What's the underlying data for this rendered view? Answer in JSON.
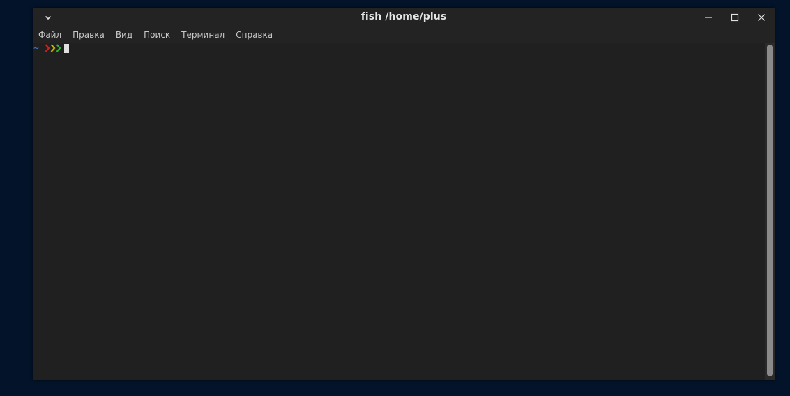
{
  "window": {
    "title": "fish /home/plus"
  },
  "menubar": {
    "items": [
      {
        "label": "Файл"
      },
      {
        "label": "Правка"
      },
      {
        "label": "Вид"
      },
      {
        "label": "Поиск"
      },
      {
        "label": "Терминал"
      },
      {
        "label": "Справка"
      }
    ]
  },
  "terminal": {
    "cwd": "~",
    "prompt_chevrons": [
      "❯",
      "❯",
      "❯"
    ],
    "chevron_colors": [
      "#d02020",
      "#c8b400",
      "#2eb82e"
    ]
  },
  "colors": {
    "desktop_bg": "#03142a",
    "terminal_bg": "#202020",
    "titlebar_bg": "#232323",
    "title_text": "#e6e6e6",
    "menu_text": "#c8c8c8",
    "scroll_thumb": "#8a8a8a"
  },
  "icons": {
    "window_menu": "chevron-down-icon",
    "minimize": "minimize-icon",
    "maximize": "maximize-icon",
    "close": "close-icon"
  }
}
